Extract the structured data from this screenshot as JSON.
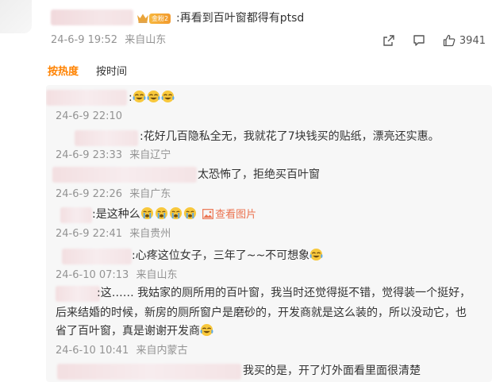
{
  "main_comment": {
    "fan_badge": "金粉2",
    "text": ":再看到百叶窗都得有ptsd",
    "time": "24-6-9 19:52",
    "location": "来自山东",
    "like_count": "3941",
    "icons": [
      "share-icon",
      "comment-icon",
      "like-icon"
    ]
  },
  "sort": {
    "hot": "按热度",
    "time": "按时间"
  },
  "replies": [
    {
      "text": ":",
      "emoji_count": 3,
      "time": "24-6-9 22:10",
      "location": ""
    },
    {
      "text": ":花好几百隐私全无，我就花了7块钱买的贴纸，漂亮还实惠。",
      "time": "24-6-9 23:33",
      "location": "来自辽宁"
    },
    {
      "text": "太恐怖了，拒绝买百叶窗",
      "time": "24-6-9 22:26",
      "location": "来自广东"
    },
    {
      "text": ":是这种么",
      "emoji_count": 4,
      "view_pic": "查看图片",
      "time": "24-6-9 22:41",
      "location": "来自贵州"
    },
    {
      "text": ":心疼这位女子，三年了~~不可想象",
      "time": "24-6-10 07:13",
      "location": "来自山东"
    },
    {
      "line1": ":这…… 我姑家的厕所用的百叶窗，我当时还觉得挺不错，觉得装一个挺好，",
      "line2": "后来结婚的时候，新房的厕所窗户是磨砂的，开发商就是这么装的，所以没动它，也",
      "line3": "省了百叶窗，真是谢谢开发商",
      "time": "24-6-10 10:41",
      "location": "来自内蒙古"
    },
    {
      "text": "我买的是，开了灯外面看里面很清楚"
    }
  ]
}
